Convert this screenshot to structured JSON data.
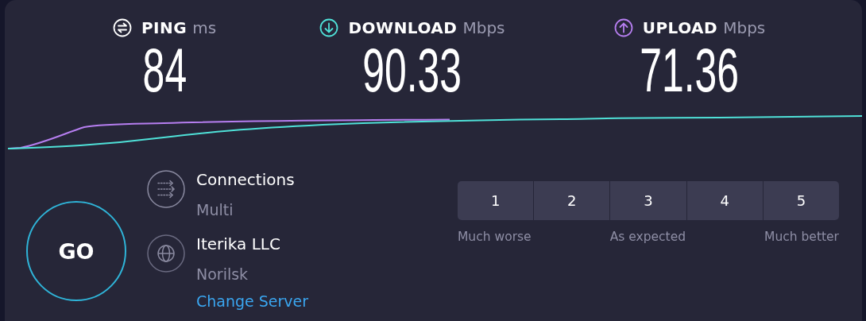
{
  "metrics": [
    {
      "kind": "ping",
      "label": "PING",
      "unit": "ms",
      "value": "84",
      "color": "#ffffff"
    },
    {
      "kind": "download",
      "label": "DOWNLOAD",
      "unit": "Mbps",
      "value": "90.33",
      "color": "#4fe1d8"
    },
    {
      "kind": "upload",
      "label": "UPLOAD",
      "unit": "Mbps",
      "value": "71.36",
      "color": "#b67ef0"
    }
  ],
  "go_button": {
    "label": "GO"
  },
  "connection": {
    "kind": "connections",
    "title": "Connections",
    "value": "Multi"
  },
  "server": {
    "kind": "server",
    "title": "Iterika LLC",
    "location": "Norilsk",
    "link": "Change Server"
  },
  "rating": {
    "options": [
      {
        "label": "1",
        "selected": false
      },
      {
        "label": "2",
        "selected": false
      },
      {
        "label": "3",
        "selected": false
      },
      {
        "label": "4",
        "selected": false
      },
      {
        "label": "5",
        "selected": false
      }
    ],
    "scale_labels": [
      "Much worse",
      "As expected",
      "Much better"
    ]
  }
}
